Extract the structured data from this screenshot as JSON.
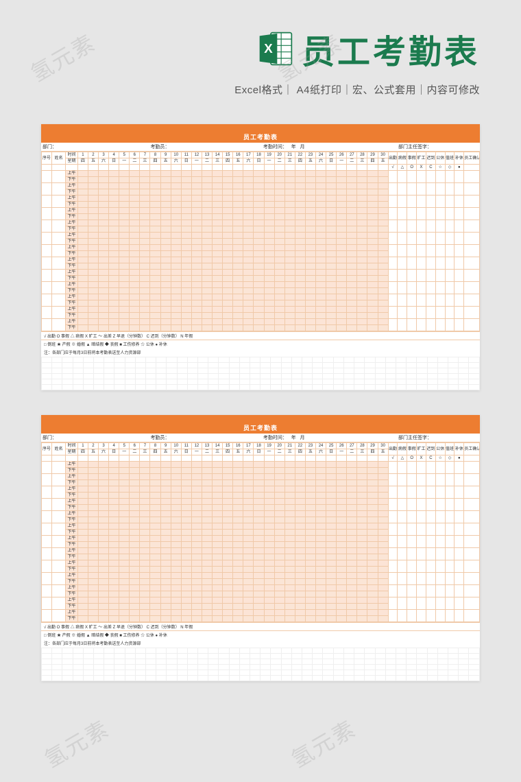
{
  "header": {
    "title": "员工考勤表",
    "subtitle": "Excel格式｜ A4纸打印｜宏、公式套用｜内容可修改"
  },
  "sheet": {
    "title": "员工考勤表",
    "dept_label": "部门：",
    "checker_label": "考勤员：",
    "time_label": "考勤时间：",
    "year_label": "年",
    "month_label": "月",
    "signer_label": "部门主任签字：",
    "col_seq": "序号",
    "col_name": "姓名",
    "col_time": "时间",
    "days": [
      "1",
      "2",
      "3",
      "4",
      "5",
      "6",
      "7",
      "8",
      "9",
      "10",
      "11",
      "12",
      "13",
      "14",
      "15",
      "16",
      "17",
      "18",
      "19",
      "20",
      "21",
      "22",
      "23",
      "24",
      "25",
      "26",
      "27",
      "28",
      "29",
      "30"
    ],
    "weekday_label": "星期",
    "weekdays": [
      "四",
      "五",
      "六",
      "日",
      "一",
      "二",
      "三",
      "四",
      "五",
      "六",
      "日",
      "一",
      "二",
      "三",
      "四",
      "五",
      "六",
      "日",
      "一",
      "二",
      "三",
      "四",
      "五",
      "六",
      "日",
      "一",
      "二",
      "三",
      "四",
      "五"
    ],
    "summary_cols": [
      "出勤",
      "病假",
      "事假",
      "旷工",
      "迟到",
      "公休",
      "值班",
      "补休"
    ],
    "summary_symbols": [
      "√",
      "△",
      "O",
      "X",
      "C",
      "☆",
      "◇",
      "●"
    ],
    "confirm_col": "员工确认",
    "am": "上午",
    "pm": "下午",
    "row_pairs": 13,
    "legend1": "√ 出勤   O 事假   △ 病假        X 旷工    ～ 出差    Z 早退（分钟数）    C 迟到（分钟数）        N 年假",
    "legend2": "□ 倒班           ★ 产假    ※ 婚假      ▲ 暗结假     ◆ 丧假       ■ 工伤修养     ☆ 公休                ● 补休",
    "note": "注：各部门应于每月3日前将本考勤表送至人力资源部"
  },
  "watermark": "氢元素"
}
